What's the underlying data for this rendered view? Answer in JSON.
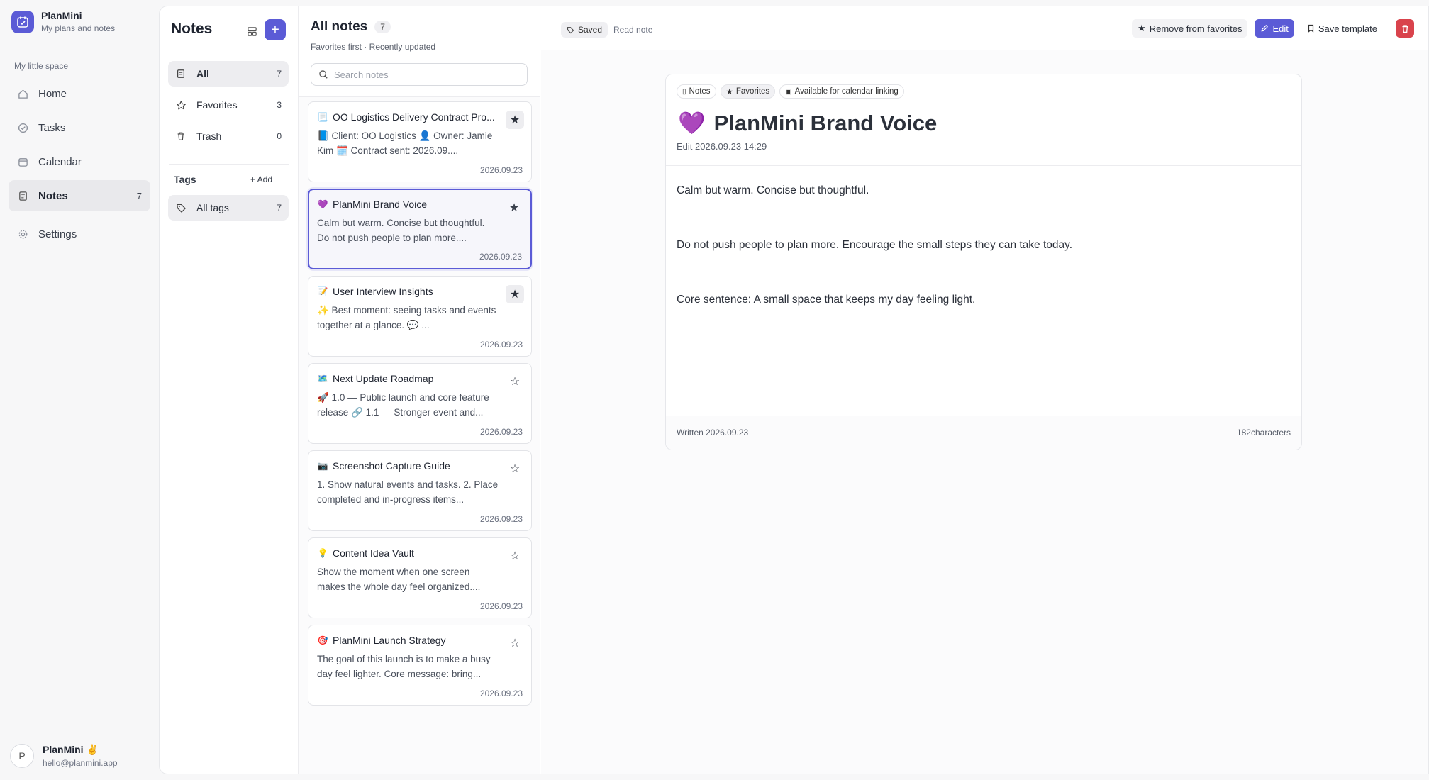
{
  "app": {
    "name": "PlanMini",
    "subtitle": "My plans and notes",
    "space_label": "My little space",
    "nav": [
      {
        "label": "Home",
        "icon": "home-icon",
        "count": ""
      },
      {
        "label": "Tasks",
        "icon": "check-circle-icon",
        "count": ""
      },
      {
        "label": "Calendar",
        "icon": "calendar-icon",
        "count": ""
      },
      {
        "label": "Notes",
        "icon": "notes-icon",
        "count": "7"
      },
      {
        "label": "Settings",
        "icon": "gear-icon",
        "count": ""
      }
    ],
    "user": {
      "avatar_letter": "P",
      "name": "PlanMini ✌️",
      "email": "hello@planmini.app"
    },
    "accent": "#5b5bd6"
  },
  "notes_sidebar": {
    "title": "Notes",
    "filters": [
      {
        "label": "All",
        "count": "7"
      },
      {
        "label": "Favorites",
        "count": "3"
      },
      {
        "label": "Trash",
        "count": "0"
      }
    ],
    "tags_label": "Tags",
    "tags_add": "+ Add",
    "all_tags": {
      "label": "All tags",
      "count": "7"
    }
  },
  "notes_list": {
    "title": "All notes",
    "count": "7",
    "subtitle": "Favorites first · Recently updated",
    "search_placeholder": "Search notes",
    "notes": [
      {
        "emoji": "📃",
        "title": "OO Logistics Delivery Contract Pro...",
        "body": "📘 Client: OO Logistics 👤 Owner: Jamie Kim 🗓️ Contract sent: 2026.09....",
        "date": "2026.09.23",
        "favorite": true
      },
      {
        "emoji": "💜",
        "title": "PlanMini Brand Voice",
        "body": "Calm but warm. Concise but thoughtful. Do not push people to plan more....",
        "date": "2026.09.23",
        "favorite": true
      },
      {
        "emoji": "📝",
        "title": "User Interview Insights",
        "body": "✨ Best moment: seeing tasks and events together at a glance. 💬 ...",
        "date": "2026.09.23",
        "favorite": true
      },
      {
        "emoji": "🗺️",
        "title": "Next Update Roadmap",
        "body": "🚀 1.0 — Public launch and core feature release 🔗 1.1 — Stronger event and...",
        "date": "2026.09.23",
        "favorite": false
      },
      {
        "emoji": "📷",
        "title": "Screenshot Capture Guide",
        "body": "1. Show natural events and tasks. 2. Place completed and in-progress items...",
        "date": "2026.09.23",
        "favorite": false
      },
      {
        "emoji": "💡",
        "title": "Content Idea Vault",
        "body": "Show the moment when one screen makes the whole day feel organized....",
        "date": "2026.09.23",
        "favorite": false
      },
      {
        "emoji": "🎯",
        "title": "PlanMini Launch Strategy",
        "body": "The goal of this launch is to make a busy day feel lighter. Core message: bring...",
        "date": "2026.09.23",
        "favorite": false
      }
    ]
  },
  "detail": {
    "saved": "Saved",
    "mode": "Read note",
    "actions": {
      "remove_fav": "Remove from favorites",
      "edit": "Edit",
      "save_template": "Save template"
    },
    "chips": [
      "Notes",
      "Favorites",
      "Available for calendar linking"
    ],
    "title_emoji": "💜",
    "title": "PlanMini Brand Voice",
    "edited": "Edit 2026.09.23 14:29",
    "paragraphs": [
      "Calm but warm. Concise but thoughtful.",
      "Do not push people to plan more. Encourage the small steps they can take today.",
      "Core sentence: A small space that keeps my day feeling light."
    ],
    "written": "Written 2026.09.23",
    "characters": "182characters"
  }
}
